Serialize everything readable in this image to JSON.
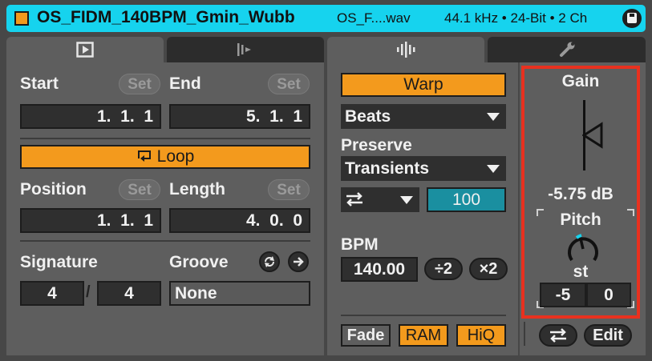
{
  "title_bar": {
    "clip_name": "OS_FIDM_140BPM_Gmin_Wubb",
    "file_name": "OS_F....wav",
    "file_info": "44.1 kHz • 24-Bit • 2 Ch"
  },
  "tabs": [
    {
      "icon": "play-square-icon"
    },
    {
      "icon": "envelope-icon"
    },
    {
      "icon": "waveform-icon"
    },
    {
      "icon": "wrench-icon"
    }
  ],
  "clip": {
    "start_label": "Start",
    "start_set": "Set",
    "start_value": "1.  1.  1",
    "end_label": "End",
    "end_set": "Set",
    "end_value": "5.  1.  1",
    "loop_label": "Loop",
    "position_label": "Position",
    "position_set": "Set",
    "position_value": "1.  1.  1",
    "length_label": "Length",
    "length_set": "Set",
    "length_value": "4.  0.  0",
    "signature_label": "Signature",
    "sig_numerator": "4",
    "sig_separator": "/",
    "sig_denominator": "4",
    "groove_label": "Groove",
    "groove_value": "None"
  },
  "sample": {
    "warp_label": "Warp",
    "warp_mode": "Beats",
    "preserve_label": "Preserve",
    "preserve_value": "Transients",
    "transient_amount": "100",
    "bpm_label": "BPM",
    "bpm_value": "140.00",
    "half_label": "÷2",
    "double_label": "×2",
    "fade_label": "Fade",
    "ram_label": "RAM",
    "hiq_label": "HiQ"
  },
  "gain_pitch": {
    "gain_label": "Gain",
    "gain_value": "-5.75 dB",
    "pitch_label": "Pitch",
    "st_label": "st",
    "semitones": "-5",
    "cents": "0",
    "edit_label": "Edit"
  },
  "colors": {
    "accent_orange": "#f39a1d",
    "title_cyan": "#16d3ee",
    "highlight_red": "#e8311f",
    "teal_value": "#1a8fa0"
  }
}
